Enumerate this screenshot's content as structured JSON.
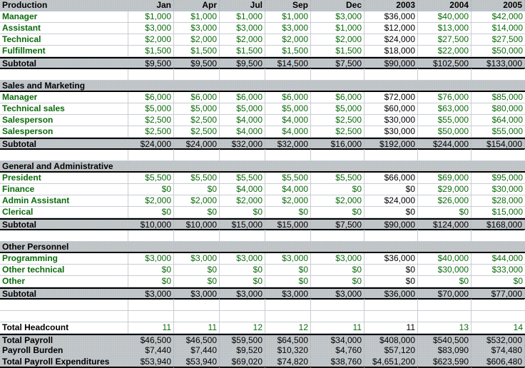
{
  "header": {
    "label": "Production",
    "columns": [
      "Jan",
      "Apr",
      "Jul",
      "Sep",
      "Dec",
      "2003",
      "2004",
      "2005"
    ]
  },
  "sections": [
    {
      "title": "Production",
      "rows": [
        {
          "label": "Manager",
          "values": [
            "$1,000",
            "$1,000",
            "$1,000",
            "$1,000",
            "$3,000",
            "$36,000",
            "$40,000",
            "$42,000"
          ]
        },
        {
          "label": "Assistant",
          "values": [
            "$3,000",
            "$3,000",
            "$3,000",
            "$3,000",
            "$1,000",
            "$12,000",
            "$13,000",
            "$14,000"
          ]
        },
        {
          "label": "Technical",
          "values": [
            "$2,000",
            "$2,000",
            "$2,000",
            "$2,000",
            "$2,000",
            "$24,000",
            "$27,500",
            "$27,500"
          ]
        },
        {
          "label": "Fulfillment",
          "values": [
            "$1,500",
            "$1,500",
            "$1,500",
            "$1,500",
            "$1,500",
            "$18,000",
            "$22,000",
            "$50,000"
          ]
        }
      ],
      "subtotal": {
        "label": "Subtotal",
        "values": [
          "$9,500",
          "$9,500",
          "$9,500",
          "$14,500",
          "$7,500",
          "$90,000",
          "$102,500",
          "$133,000"
        ]
      }
    },
    {
      "title": "Sales and Marketing",
      "rows": [
        {
          "label": "Manager",
          "values": [
            "$6,000",
            "$6,000",
            "$6,000",
            "$6,000",
            "$6,000",
            "$72,000",
            "$76,000",
            "$85,000"
          ]
        },
        {
          "label": "Technical sales",
          "values": [
            "$5,000",
            "$5,000",
            "$5,000",
            "$5,000",
            "$5,000",
            "$60,000",
            "$63,000",
            "$80,000"
          ]
        },
        {
          "label": "Salesperson",
          "values": [
            "$2,500",
            "$2,500",
            "$4,000",
            "$4,000",
            "$2,500",
            "$30,000",
            "$55,000",
            "$64,000"
          ]
        },
        {
          "label": "Salesperson",
          "values": [
            "$2,500",
            "$2,500",
            "$4,000",
            "$4,000",
            "$2,500",
            "$30,000",
            "$50,000",
            "$55,000"
          ]
        }
      ],
      "subtotal": {
        "label": "Subtotal",
        "values": [
          "$24,000",
          "$24,000",
          "$32,000",
          "$32,000",
          "$16,000",
          "$192,000",
          "$244,000",
          "$154,000"
        ]
      }
    },
    {
      "title": "General and Administrative",
      "rows": [
        {
          "label": "President",
          "values": [
            "$5,500",
            "$5,500",
            "$5,500",
            "$5,500",
            "$5,500",
            "$66,000",
            "$69,000",
            "$95,000"
          ]
        },
        {
          "label": "Finance",
          "values": [
            "$0",
            "$0",
            "$4,000",
            "$4,000",
            "$0",
            "$0",
            "$29,000",
            "$30,000"
          ]
        },
        {
          "label": "Admin Assistant",
          "values": [
            "$2,000",
            "$2,000",
            "$2,000",
            "$2,000",
            "$2,000",
            "$24,000",
            "$26,000",
            "$28,000"
          ]
        },
        {
          "label": "Clerical",
          "values": [
            "$0",
            "$0",
            "$0",
            "$0",
            "$0",
            "$0",
            "$0",
            "$15,000"
          ]
        }
      ],
      "subtotal": {
        "label": "Subtotal",
        "values": [
          "$10,000",
          "$10,000",
          "$15,000",
          "$15,000",
          "$7,500",
          "$90,000",
          "$124,000",
          "$168,000"
        ]
      }
    },
    {
      "title": "Other Personnel",
      "rows": [
        {
          "label": "Programming",
          "values": [
            "$3,000",
            "$3,000",
            "$3,000",
            "$3,000",
            "$3,000",
            "$36,000",
            "$40,000",
            "$44,000"
          ]
        },
        {
          "label": "Other technical",
          "values": [
            "$0",
            "$0",
            "$0",
            "$0",
            "$0",
            "$0",
            "$30,000",
            "$33,000"
          ]
        },
        {
          "label": "Other",
          "values": [
            "$0",
            "$0",
            "$0",
            "$0",
            "$0",
            "$0",
            "$0",
            "$0"
          ]
        }
      ],
      "subtotal": {
        "label": "Subtotal",
        "values": [
          "$3,000",
          "$3,000",
          "$3,000",
          "$3,000",
          "$3,000",
          "$36,000",
          "$70,000",
          "$77,000"
        ]
      }
    }
  ],
  "headcount": {
    "label": "Total Headcount",
    "values": [
      "11",
      "11",
      "12",
      "12",
      "11",
      "11",
      "13",
      "14"
    ]
  },
  "totals": [
    {
      "label": "Total Payroll",
      "values": [
        "$46,500",
        "$46,500",
        "$59,500",
        "$64,500",
        "$34,000",
        "$408,000",
        "$540,500",
        "$532,000"
      ]
    },
    {
      "label": "Payroll Burden",
      "values": [
        "$7,440",
        "$7,440",
        "$9,520",
        "$10,320",
        "$4,760",
        "$57,120",
        "$83,090",
        "$74,480"
      ]
    },
    {
      "label": "Total Payroll Expenditures",
      "values": [
        "$53,940",
        "$53,940",
        "$69,020",
        "$74,820",
        "$38,760",
        "$4,651,200",
        "$623,590",
        "$606,480"
      ]
    }
  ],
  "colors": {
    "input_text": "#0b6b0b",
    "formula_text": "#000000",
    "shade_fill": "#b8c4d0",
    "gridline": "#c8ccd2"
  }
}
